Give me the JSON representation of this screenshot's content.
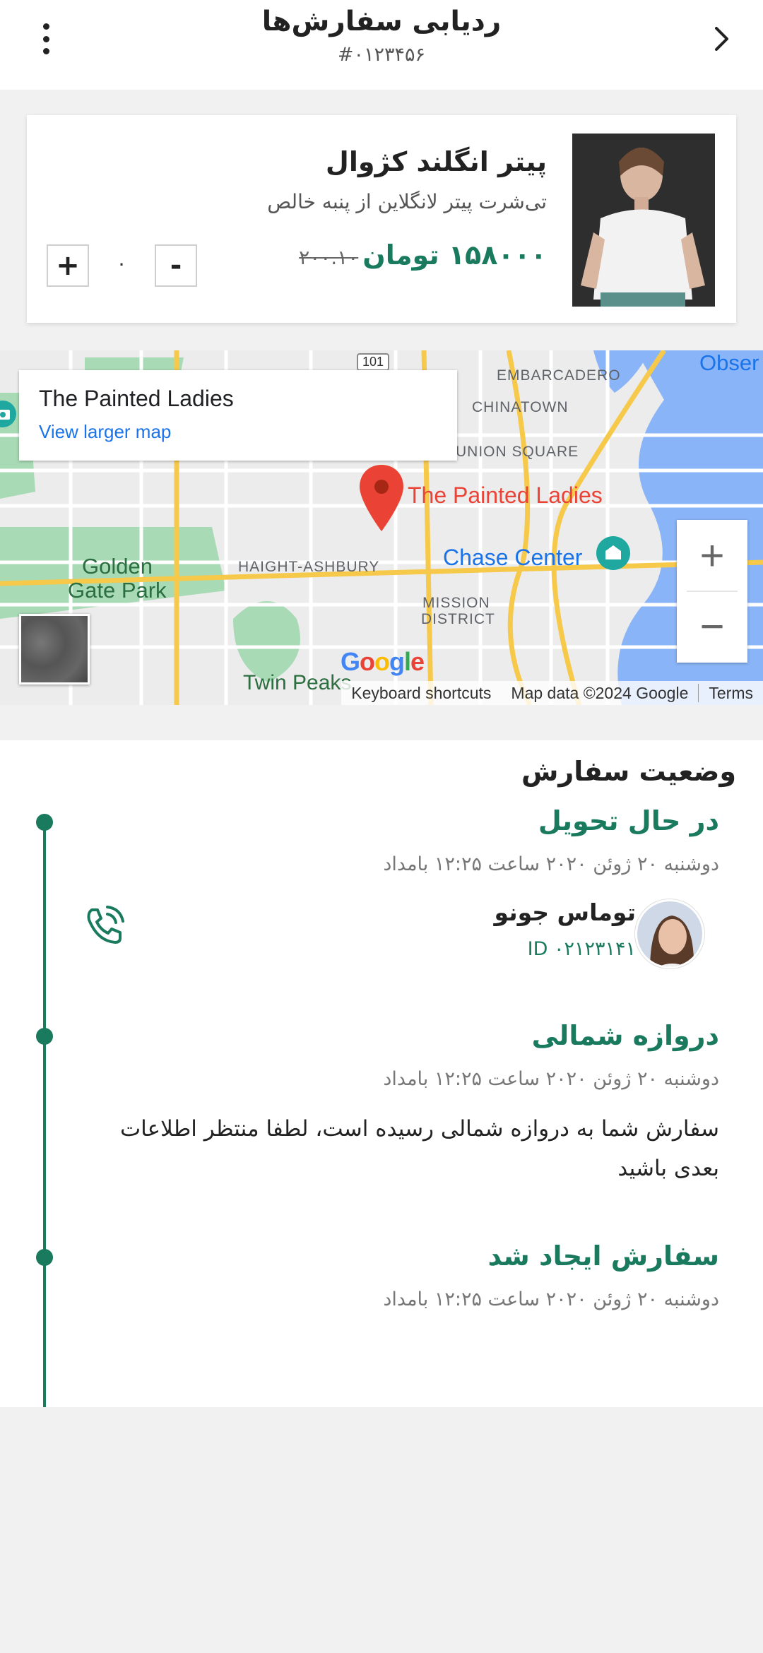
{
  "header": {
    "title": "ردیابی سفارش‌ها",
    "order_number": "#۰۱۲۳۴۵۶"
  },
  "product": {
    "title": "پیتر انگلند کژوال",
    "description": "تی‌شرت پیتر لانگلاین از پنبه خالص",
    "price": "۱۵۸۰۰۰ تومان",
    "old_price": "۲۰۰.۱۰",
    "quantity": "۰",
    "plus_label": "+",
    "minus_label": "-"
  },
  "map": {
    "place_name": "The Painted Ladies",
    "view_larger": "View larger map",
    "pin_label": "The Painted Ladies",
    "labels": {
      "embarcadero": "EMBARCADERO",
      "chinatown": "CHINATOWN",
      "union_square": "UNION SQUARE",
      "observ": "Obser",
      "golden_gate_1": "Golden",
      "golden_gate_2": "Gate Park",
      "haight": "HAIGHT-ASHBURY",
      "chase": "Chase Center",
      "mission_1": "MISSION",
      "mission_2": "DISTRICT",
      "twin_peaks": "Twin Peaks",
      "route": "101"
    },
    "google": "Google",
    "footer": {
      "shortcuts": "Keyboard shortcuts",
      "map_data": "Map data ©2024 Google",
      "terms": "Terms"
    },
    "zoom_in": "+",
    "zoom_out": "−"
  },
  "status": {
    "title": "وضعیت سفارش",
    "steps": [
      {
        "title": "در حال تحویل",
        "date": "دوشنبه ۲۰ ژوئن ۲۰۲۰ ساعت ۱۲:۲۵ بامداد"
      },
      {
        "title": "دروازه شمالی",
        "date": "دوشنبه ۲۰ ژوئن ۲۰۲۰ ساعت ۱۲:۲۵ بامداد",
        "text": "سفارش شما به دروازه شمالی رسیده است، لطفا منتظر اطلاعات بعدی باشید"
      },
      {
        "title": "سفارش ایجاد شد",
        "date": "دوشنبه ۲۰ ژوئن ۲۰۲۰ ساعت ۱۲:۲۵ بامداد"
      }
    ],
    "courier": {
      "name": "توماس جونو",
      "id": "ID ۰۲۱۲۳۱۴۱"
    }
  },
  "colors": {
    "accent": "#1a7a5e",
    "map_water": "#8ab4f8",
    "map_park": "#a8dab5",
    "map_road": "#f6c94b",
    "pin": "#ea4335"
  }
}
